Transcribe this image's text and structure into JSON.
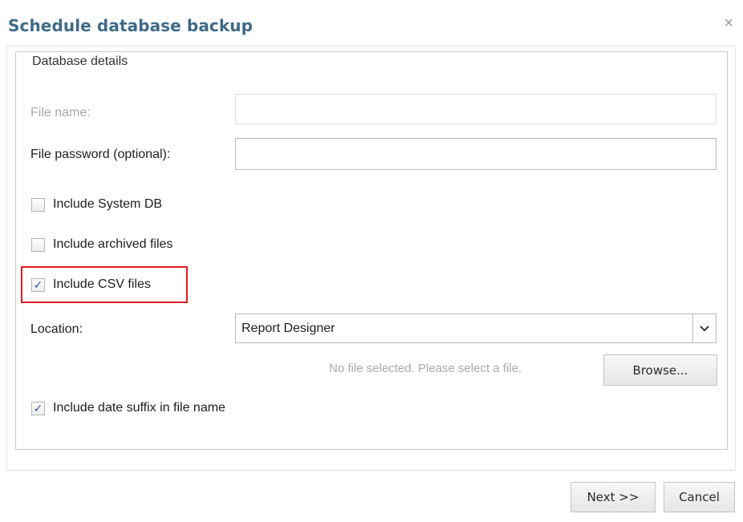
{
  "dialog": {
    "title": "Schedule database backup",
    "close_glyph": "×"
  },
  "details": {
    "legend": "Database details",
    "file_name": {
      "label": "File name:",
      "value": "",
      "disabled": true
    },
    "file_password": {
      "label": "File password (optional):",
      "value": ""
    },
    "checkboxes": [
      {
        "label": "Include System DB",
        "checked": false,
        "mark": ""
      },
      {
        "label": "Include archived files",
        "checked": false,
        "mark": ""
      },
      {
        "label": "Include CSV files",
        "checked": true,
        "mark": "✓",
        "highlighted": true
      }
    ],
    "location": {
      "label": "Location:",
      "selected": "Report Designer"
    },
    "file_status": "No file selected. Please select a file.",
    "browse_label": "Browse...",
    "date_suffix": {
      "label": "Include date suffix in file name",
      "checked": true,
      "mark": "✓"
    }
  },
  "footer": {
    "next_label": "Next >>",
    "cancel_label": "Cancel"
  },
  "icons": {
    "dropdown": "chevron-down-icon",
    "close": "close-icon",
    "check": "checkmark-icon"
  },
  "colors": {
    "title": "#3f6a88",
    "highlight": "#e11b22",
    "check": "#2856c6"
  }
}
